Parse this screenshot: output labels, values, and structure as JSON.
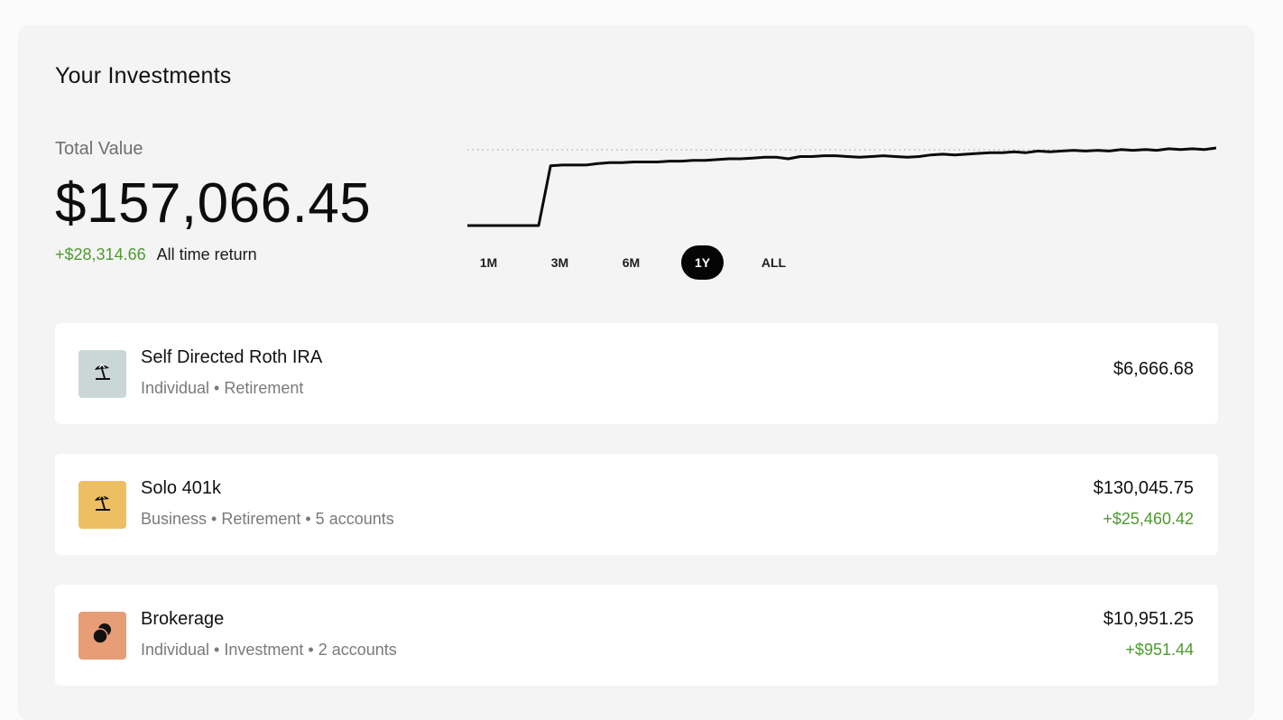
{
  "header": {
    "title": "Your Investments"
  },
  "summary": {
    "total_label": "Total Value",
    "total_value": "$157,066.45",
    "return_amount": "+$28,314.66",
    "return_label": "All time return"
  },
  "chart_data": {
    "type": "line",
    "title": "",
    "xlabel": "",
    "ylabel": "",
    "selected_range": "1Y",
    "series_shape_note_values": [
      0,
      0,
      0,
      0,
      0,
      0,
      0,
      0.77,
      0.78,
      0.78,
      0.78,
      0.8,
      0.81,
      0.81,
      0.82,
      0.82,
      0.82,
      0.83,
      0.83,
      0.84,
      0.84,
      0.85,
      0.86,
      0.86,
      0.87,
      0.88,
      0.88,
      0.86,
      0.89,
      0.89,
      0.9,
      0.9,
      0.89,
      0.88,
      0.89,
      0.9,
      0.89,
      0.88,
      0.89,
      0.91,
      0.92,
      0.91,
      0.92,
      0.93,
      0.94,
      0.94,
      0.95,
      0.94,
      0.96,
      0.95,
      0.96,
      0.97,
      0.96,
      0.97,
      0.96,
      0.98,
      0.97,
      0.98,
      0.97,
      0.99,
      0.98,
      0.99,
      0.98,
      1.0
    ],
    "reference_line": "dotted"
  },
  "ranges": {
    "items": [
      "1M",
      "3M",
      "6M",
      "1Y",
      "ALL"
    ],
    "active": "1Y"
  },
  "accounts": [
    {
      "name": "Self Directed Roth IRA",
      "meta": "Individual • Retirement",
      "value": "$6,666.68",
      "gain": "",
      "icon": "beach-umbrella-icon",
      "icon_bg": "#c9d8d6"
    },
    {
      "name": "Solo 401k",
      "meta": "Business • Retirement • 5 accounts",
      "value": "$130,045.75",
      "gain": "+$25,460.42",
      "icon": "beach-umbrella-icon",
      "icon_bg": "#eebf62"
    },
    {
      "name": "Brokerage",
      "meta": "Individual • Investment • 2 accounts",
      "value": "$10,951.25",
      "gain": "+$951.44",
      "icon": "overlapping-circles-icon",
      "icon_bg": "#e79d76"
    }
  ]
}
